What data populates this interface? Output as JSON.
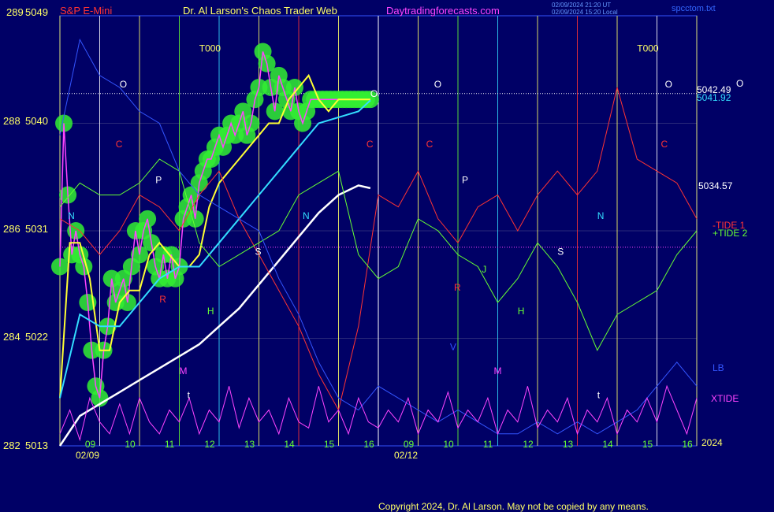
{
  "header": {
    "instrument": "S&P E-Mini",
    "title": "Dr. Al Larson's Chaos Trader Web",
    "site": "Daytradingforecasts.com",
    "timestamp_utc": "02/09/2024 21:20 UT",
    "timestamp_local": "02/09/2024 15:20 Local",
    "file": "spcctom.txt"
  },
  "footer": {
    "copyright": "Copyright 2024, Dr. Al Larson. May not be copied by any means."
  },
  "colors": {
    "background": "#000066",
    "price": "#ff44ff",
    "fast_ma": "#ffff33",
    "slow_ma": "#33ddff",
    "long_ma": "#ffffff",
    "tide1": "#ff3333",
    "tide2": "#66ff33",
    "xtide": "#ff44ff",
    "lb": "#3355ff",
    "glow": "#33ee33"
  },
  "chart_data": {
    "type": "line",
    "title": "S&P E-Mini",
    "y_axis_left": {
      "ticks": [
        {
          "left": "289",
          "right": "5049",
          "value": 5049
        },
        {
          "left": "288",
          "right": "5040",
          "value": 5040
        },
        {
          "left": "286",
          "right": "5031",
          "value": 5031
        },
        {
          "left": "284",
          "right": "5022",
          "value": 5022
        },
        {
          "left": "282",
          "right": "5013",
          "value": 5013
        }
      ],
      "ylim": [
        5013,
        5049
      ]
    },
    "x_axis": {
      "hour_ticks": [
        "09",
        "10",
        "11",
        "12",
        "13",
        "14",
        "15",
        "16",
        "09",
        "10",
        "11",
        "12",
        "13",
        "14",
        "15",
        "16"
      ],
      "date_labels": [
        "02/09",
        "02/12"
      ],
      "year_label": "2024",
      "x_range_hours": [
        0,
        16
      ]
    },
    "price_labels": {
      "last": "5042.49",
      "average": "5041.92",
      "midline": "5034.57"
    },
    "legend": [
      "-TIDE 1",
      "+TIDE 2",
      "LB",
      "XTIDE"
    ],
    "marker_letters": [
      "O",
      "C",
      "P",
      "N",
      "S",
      "R",
      "H",
      "M",
      "J",
      "V",
      "t",
      "T000"
    ],
    "series": [
      {
        "name": "S&P E-Mini",
        "role": "price",
        "x": [
          0,
          0.1,
          0.2,
          0.3,
          0.4,
          0.5,
          0.6,
          0.7,
          0.8,
          0.9,
          1.0,
          1.1,
          1.2,
          1.3,
          1.4,
          1.5,
          1.6,
          1.7,
          1.8,
          1.9,
          2.0,
          2.1,
          2.2,
          2.3,
          2.4,
          2.5,
          2.6,
          2.7,
          2.8,
          2.9,
          3.0,
          3.1,
          3.2,
          3.3,
          3.4,
          3.5,
          3.6,
          3.7,
          3.8,
          3.9,
          4.0,
          4.1,
          4.2,
          4.3,
          4.4,
          4.5,
          4.6,
          4.7,
          4.8,
          4.9,
          5.0,
          5.1,
          5.2,
          5.3,
          5.4,
          5.5,
          5.6,
          5.7,
          5.8,
          5.9,
          6.0,
          6.1,
          6.2,
          6.3,
          6.4,
          6.5,
          6.6,
          6.7,
          6.8,
          6.9,
          7.0,
          7.1,
          7.2,
          7.3,
          7.4,
          7.5,
          7.6,
          7.7,
          7.8
        ],
        "values": [
          5028,
          5040,
          5034,
          5029,
          5031,
          5029,
          5028,
          5025,
          5021,
          5018,
          5017,
          5021,
          5023,
          5027,
          5025,
          5026,
          5027,
          5025,
          5028,
          5031,
          5029,
          5031,
          5032,
          5030,
          5028,
          5027,
          5029,
          5027,
          5029,
          5027,
          5028,
          5032,
          5033,
          5034,
          5032,
          5035,
          5036,
          5037,
          5037,
          5038,
          5039,
          5038,
          5039,
          5040,
          5039,
          5040,
          5041,
          5039,
          5040,
          5042,
          5043,
          5046,
          5045,
          5043,
          5041,
          5044,
          5043,
          5042,
          5041,
          5043,
          5041,
          5040,
          5041,
          5042,
          5042,
          5042,
          5042,
          5042,
          5042,
          5042,
          5042,
          5042,
          5042,
          5042,
          5042,
          5042,
          5042,
          5042,
          5042
        ]
      },
      {
        "name": "fast average",
        "role": "fast_ma",
        "x": [
          0,
          0.25,
          0.5,
          0.75,
          1,
          1.25,
          1.5,
          1.75,
          2,
          2.25,
          2.5,
          2.75,
          3,
          3.25,
          3.5,
          3.75,
          4,
          4.25,
          4.5,
          4.75,
          5,
          5.25,
          5.5,
          5.75,
          6,
          6.25,
          6.5,
          6.75,
          7,
          7.25,
          7.5,
          7.8
        ],
        "values": [
          5017,
          5030,
          5030,
          5027,
          5021,
          5021,
          5025,
          5026,
          5026,
          5029,
          5030,
          5029,
          5028,
          5028,
          5029,
          5033,
          5035,
          5036,
          5037,
          5038,
          5039,
          5040,
          5040,
          5042,
          5043,
          5044,
          5042,
          5041,
          5042,
          5042,
          5042,
          5042
        ]
      },
      {
        "name": "slow average",
        "role": "slow_ma",
        "x": [
          0,
          0.5,
          1,
          1.5,
          2,
          2.5,
          3,
          3.5,
          4,
          4.5,
          5,
          5.5,
          6,
          6.5,
          7,
          7.5,
          7.8
        ],
        "values": [
          5017,
          5024,
          5023,
          5023,
          5025,
          5027,
          5028,
          5028,
          5030,
          5032,
          5034,
          5036,
          5038,
          5040,
          5040.5,
          5041,
          5041.92
        ]
      },
      {
        "name": "long average",
        "role": "long_ma",
        "x": [
          0,
          0.5,
          1,
          1.5,
          2,
          2.5,
          3,
          3.5,
          4,
          4.5,
          5,
          5.5,
          6,
          6.5,
          7,
          7.5,
          7.8
        ],
        "values": [
          5013,
          5015.5,
          5016.5,
          5017.5,
          5018.5,
          5019.5,
          5020.5,
          5021.5,
          5023,
          5024.5,
          5026.5,
          5028.5,
          5030.5,
          5032.5,
          5034,
          5034.8,
          5034.57
        ]
      },
      {
        "name": "-TIDE 1",
        "role": "tide1",
        "x": [
          0,
          0.5,
          1,
          1.5,
          2,
          2.5,
          3,
          3.5,
          4,
          4.5,
          5,
          5.5,
          6,
          6.5,
          7,
          7.5,
          8,
          8.5,
          9,
          9.5,
          10,
          10.5,
          11,
          11.5,
          12,
          12.5,
          13,
          13.5,
          14,
          14.5,
          15,
          15.5,
          16
        ],
        "values": [
          5032,
          5031,
          5029,
          5031,
          5034,
          5033,
          5031,
          5034,
          5036,
          5032,
          5029,
          5026,
          5023,
          5019,
          5016,
          5023,
          5034,
          5033,
          5036,
          5032,
          5030,
          5033,
          5034,
          5031,
          5034,
          5036,
          5034,
          5036,
          5043,
          5037,
          5036,
          5035,
          5032
        ]
      },
      {
        "name": "+TIDE 2",
        "role": "tide2",
        "x": [
          0,
          0.5,
          1,
          1.5,
          2,
          2.5,
          3,
          3.5,
          4,
          4.5,
          5,
          5.5,
          6,
          6.5,
          7,
          7.5,
          8,
          8.5,
          9,
          9.5,
          10,
          10.5,
          11,
          11.5,
          12,
          12.5,
          13,
          13.5,
          14,
          14.5,
          15,
          15.5,
          16
        ],
        "values": [
          5033,
          5035,
          5034,
          5034,
          5035,
          5037,
          5036,
          5030,
          5028,
          5029,
          5030,
          5031,
          5034,
          5035,
          5036,
          5029,
          5027,
          5028,
          5032,
          5031,
          5029,
          5028,
          5025,
          5027,
          5030,
          5028,
          5025,
          5021,
          5024,
          5025,
          5026,
          5029,
          5031
        ]
      },
      {
        "name": "LB",
        "role": "lb",
        "x": [
          0,
          0.5,
          1,
          1.5,
          2,
          2.5,
          3,
          3.5,
          4,
          4.5,
          5,
          5.5,
          6,
          6.5,
          7,
          7.5,
          8,
          8.5,
          9,
          9.5,
          10,
          10.5,
          11,
          11.5,
          12,
          12.5,
          13,
          13.5,
          14,
          14.5,
          15,
          15.5,
          16
        ],
        "values": [
          5039,
          5047,
          5044,
          5043,
          5041,
          5040,
          5036,
          5034,
          5033,
          5032,
          5031,
          5027,
          5024,
          5020,
          5017,
          5016,
          5018,
          5017,
          5016,
          5015,
          5016,
          5015,
          5014,
          5014,
          5015,
          5014,
          5015,
          5014,
          5015,
          5016,
          5018,
          5020,
          5018
        ]
      },
      {
        "name": "XTIDE",
        "role": "xtide",
        "x": [
          0,
          0.25,
          0.5,
          0.75,
          1,
          1.25,
          1.5,
          1.75,
          2,
          2.25,
          2.5,
          2.75,
          3,
          3.25,
          3.5,
          3.75,
          4,
          4.25,
          4.5,
          4.75,
          5,
          5.25,
          5.5,
          5.75,
          6,
          6.25,
          6.5,
          6.75,
          7,
          7.25,
          7.5,
          7.75,
          8,
          8.25,
          8.5,
          8.75,
          9,
          9.25,
          9.5,
          9.75,
          10,
          10.25,
          10.5,
          10.75,
          11,
          11.25,
          11.5,
          11.75,
          12,
          12.25,
          12.5,
          12.75,
          13,
          13.25,
          13.5,
          13.75,
          14,
          14.25,
          14.5,
          14.75,
          15,
          15.25,
          15.5,
          15.75,
          16
        ],
        "values": [
          5014,
          5016,
          5013.5,
          5017,
          5015,
          5014,
          5016.5,
          5014,
          5017,
          5015,
          5014,
          5016,
          5015,
          5017,
          5014,
          5016,
          5015,
          5018,
          5014.5,
          5017,
          5015,
          5016,
          5014,
          5017,
          5015,
          5014.5,
          5018,
          5015,
          5016,
          5014,
          5017,
          5015,
          5014.5,
          5016,
          5015,
          5017,
          5014,
          5016,
          5015,
          5017.5,
          5014.5,
          5016,
          5015,
          5017,
          5014,
          5016,
          5015,
          5018,
          5014.5,
          5016,
          5015,
          5017,
          5014,
          5016,
          5015,
          5017,
          5014,
          5016,
          5015,
          5017,
          5015,
          5018,
          5016,
          5014,
          5017
        ]
      }
    ],
    "grid": true,
    "legend_position": "right"
  }
}
